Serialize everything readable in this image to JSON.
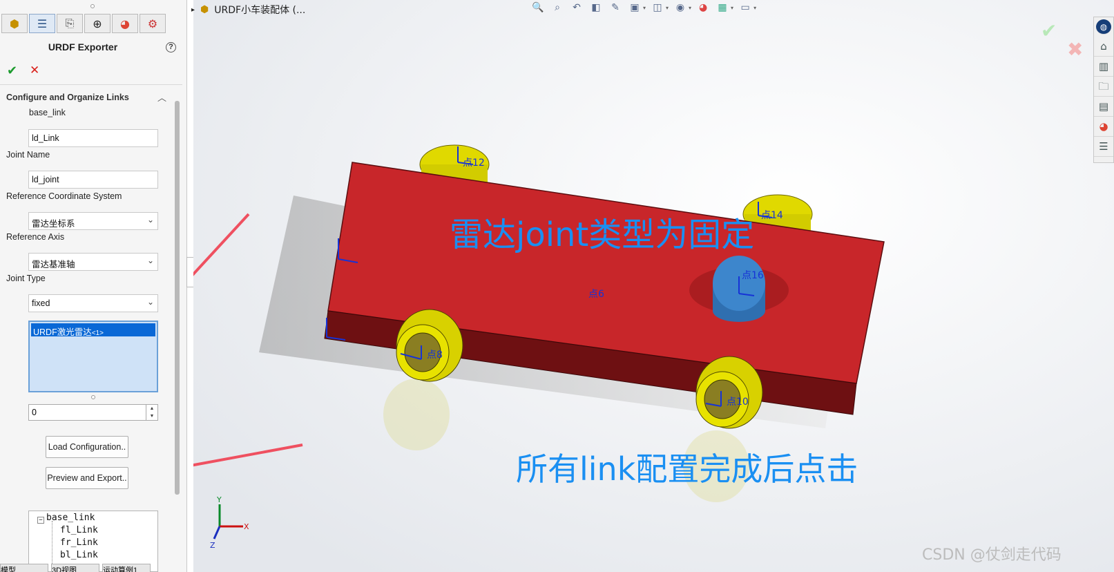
{
  "panel": {
    "tabs": [
      "feature-manager-icon",
      "property-manager-icon",
      "configuration-manager-icon",
      "dimxpert-icon",
      "appearance-icon",
      "simulation-icon"
    ],
    "title": "URDF Exporter",
    "help": "?",
    "ok": "✔",
    "cancel": "✕",
    "group_title": "Configure and Organize Links",
    "parent_link": "base_link",
    "link_name": "ld_Link",
    "joint_name_label": "Joint Name",
    "joint_name": "ld_joint",
    "ref_coord_label": "Reference Coordinate System",
    "ref_coord": "雷达坐标系",
    "ref_axis_label": "Reference Axis",
    "ref_axis": "雷达基准轴",
    "joint_type_label": "Joint Type",
    "joint_type": "fixed",
    "selected_component": "URDF激光雷达",
    "selected_component_suffix": "<1>",
    "child_count": "0",
    "load_button": "Load Configuration..",
    "export_button": "Preview and Export..",
    "tree": {
      "root": "base_link",
      "children": [
        "fl_Link",
        "fr_Link",
        "bl_Link"
      ]
    }
  },
  "breadcrumb": "URDF小车装配体 (...",
  "toolbar_icons": [
    "zoom-to-fit-icon",
    "zoom-to-area-icon",
    "previous-view-icon",
    "section-view-icon",
    "dynamic-annotation-icon",
    "view-orientation-icon",
    "display-style-icon",
    "hide-show-icon",
    "edit-appearance-icon",
    "apply-scene-icon",
    "view-settings-icon"
  ],
  "taskpane_icons": [
    "solidworks-resources-icon",
    "home-icon",
    "design-library-icon",
    "file-explorer-icon",
    "view-palette-icon",
    "appearances-icon",
    "custom-properties-icon"
  ],
  "scene": {
    "points": [
      "点12",
      "点14",
      "点16",
      "点6",
      "点8",
      "点10"
    ],
    "triad": {
      "x": "X",
      "y": "Y",
      "z": "Z"
    },
    "colors": {
      "body": "#c8262a",
      "body_side": "#6e1012",
      "wheel": "#e8e200",
      "lidar": "#3d86cc",
      "annotation": "#1a8ff2",
      "arrow": "#ef5060"
    }
  },
  "annotations": {
    "joint_note": "雷达joint类型为固定",
    "export_note": "所有link配置完成后点击"
  },
  "watermark": "CSDN @仗剑走代码",
  "bottom_tabs": [
    "模型",
    "3D视图",
    "运动算例1"
  ]
}
